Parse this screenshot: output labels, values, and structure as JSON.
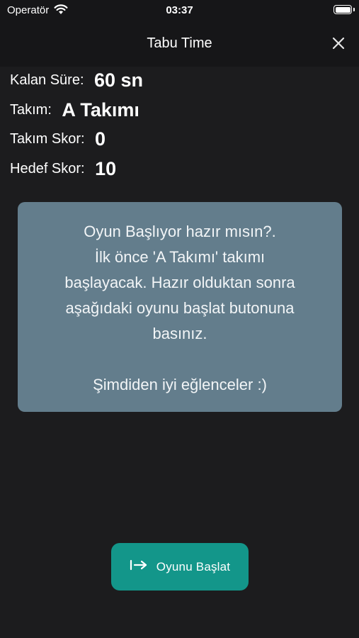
{
  "status": {
    "carrier": "Operatör",
    "time": "03:37"
  },
  "nav": {
    "title": "Tabu Time"
  },
  "info": {
    "time_label": "Kalan Süre:",
    "time_value": "60 sn",
    "team_label": "Takım:",
    "team_value": "A Takımı",
    "team_score_label": "Takım Skor:",
    "team_score_value": "0",
    "target_label": "Hedef Skor:",
    "target_value": "10"
  },
  "message": {
    "lines": [
      "Oyun Başlıyor hazır mısın?.",
      "İlk önce 'A Takımı' takımı",
      "başlayacak. Hazır olduktan sonra",
      "aşağıdaki oyunu başlat butonuna",
      "basınız."
    ],
    "closing": "Şimdiden iyi eğlenceler :)"
  },
  "start_button": {
    "label": "Oyunu Başlat",
    "icon": "login-arrow-icon"
  },
  "colors": {
    "background": "#1c1c1e",
    "card": "#637d8c",
    "accent": "#13968a"
  }
}
